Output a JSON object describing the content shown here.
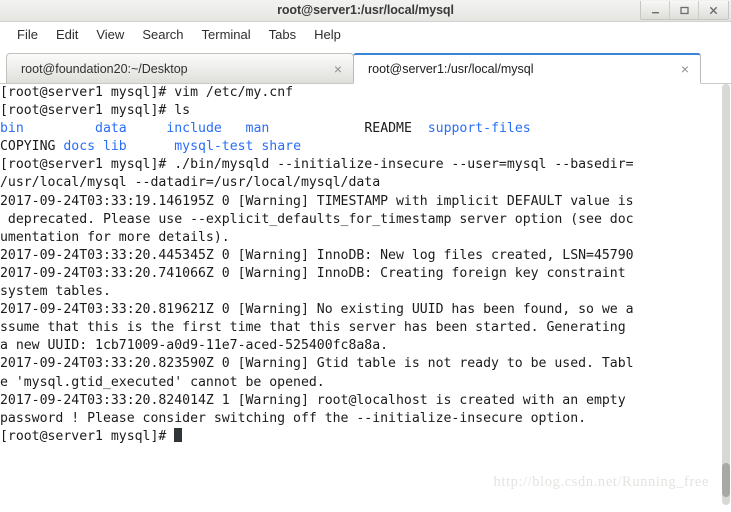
{
  "window": {
    "title": "root@server1:/usr/local/mysql",
    "buttons": [
      {
        "name": "minimize",
        "glyph": "minimize-icon"
      },
      {
        "name": "maximize",
        "glyph": "maximize-icon"
      },
      {
        "name": "close",
        "glyph": "close-icon"
      }
    ]
  },
  "menubar": {
    "items": [
      "File",
      "Edit",
      "View",
      "Search",
      "Terminal",
      "Tabs",
      "Help"
    ]
  },
  "tabs": [
    {
      "label": "root@foundation20:~/Desktop",
      "active": false,
      "close": "×"
    },
    {
      "label": "root@server1:/usr/local/mysql",
      "active": true,
      "close": "×"
    }
  ],
  "terminal": {
    "prompt": "[root@server1 mysql]# ",
    "lines": [
      {
        "type": "prompt",
        "command": "vim /etc/my.cnf"
      },
      {
        "type": "prompt",
        "command": "ls"
      },
      {
        "type": "ls",
        "cells": [
          {
            "text": "bin",
            "dir": true,
            "pad": 9
          },
          {
            "text": "data",
            "dir": true,
            "pad": 5
          },
          {
            "text": "include",
            "dir": true,
            "pad": 3
          },
          {
            "text": "man",
            "dir": true,
            "pad": 12
          },
          {
            "text": "README",
            "dir": false,
            "pad": 2
          },
          {
            "text": "support-files",
            "dir": true,
            "pad": 0
          }
        ]
      },
      {
        "type": "ls",
        "cells": [
          {
            "text": "COPYING",
            "dir": false,
            "pad": 1
          },
          {
            "text": "docs",
            "dir": true,
            "pad": 1
          },
          {
            "text": "lib",
            "dir": true,
            "pad": 6
          },
          {
            "text": "mysql-test",
            "dir": true,
            "pad": 1
          },
          {
            "text": "share",
            "dir": true,
            "pad": 0
          }
        ]
      },
      {
        "type": "prompt",
        "command": "./bin/mysqld --initialize-insecure --user=mysql --basedir="
      },
      {
        "type": "output",
        "text": "/usr/local/mysql --datadir=/usr/local/mysql/data"
      },
      {
        "type": "output",
        "text": "2017-09-24T03:33:19.146195Z 0 [Warning] TIMESTAMP with implicit DEFAULT value is"
      },
      {
        "type": "output",
        "text": " deprecated. Please use --explicit_defaults_for_timestamp server option (see doc"
      },
      {
        "type": "output",
        "text": "umentation for more details)."
      },
      {
        "type": "output",
        "text": "2017-09-24T03:33:20.445345Z 0 [Warning] InnoDB: New log files created, LSN=45790"
      },
      {
        "type": "output",
        "text": "2017-09-24T03:33:20.741066Z 0 [Warning] InnoDB: Creating foreign key constraint"
      },
      {
        "type": "output",
        "text": "system tables."
      },
      {
        "type": "output",
        "text": "2017-09-24T03:33:20.819621Z 0 [Warning] No existing UUID has been found, so we a"
      },
      {
        "type": "output",
        "text": "ssume that this is the first time that this server has been started. Generating"
      },
      {
        "type": "output",
        "text": "a new UUID: 1cb71009-a0d9-11e7-aced-525400fc8a8a."
      },
      {
        "type": "output",
        "text": "2017-09-24T03:33:20.823590Z 0 [Warning] Gtid table is not ready to be used. Tabl"
      },
      {
        "type": "output",
        "text": "e 'mysql.gtid_executed' cannot be opened."
      },
      {
        "type": "output",
        "text": "2017-09-24T03:33:20.824014Z 1 [Warning] root@localhost is created with an empty"
      },
      {
        "type": "output",
        "text": "password ! Please consider switching off the --initialize-insecure option."
      },
      {
        "type": "cursor",
        "command": ""
      }
    ]
  },
  "watermark": {
    "text": "http://blog.csdn.net/Running_free"
  },
  "colors": {
    "directory_blue": "#2a6ef5",
    "text": "#1b1b1b",
    "tab_active_accent": "#3a84d8",
    "background": "#ffffff"
  }
}
